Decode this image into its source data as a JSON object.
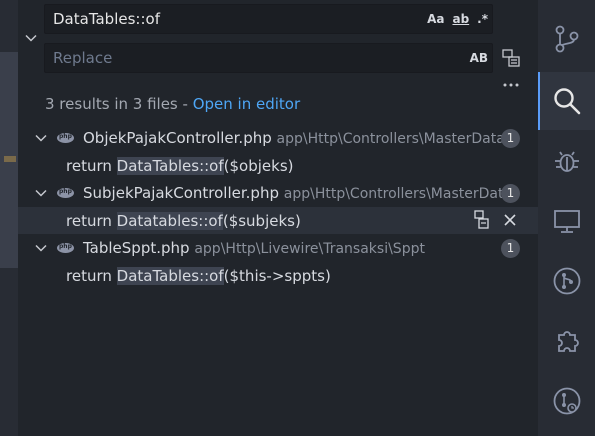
{
  "search": {
    "find_value": "DataTables::of",
    "find_options": {
      "match_case": "Aa",
      "whole_word": "ab",
      "regex": ".*"
    },
    "replace_placeholder": "Replace",
    "replace_option": "AB"
  },
  "summary": {
    "text": "3 results in 3 files - ",
    "link": "Open in editor"
  },
  "results": [
    {
      "file": "ObjekPajakController.php",
      "path": "app\\Http\\Controllers\\MasterData",
      "count": "1",
      "match": {
        "before": "return ",
        "highlight": "DataTables::of",
        "after": "($objeks)"
      }
    },
    {
      "file": "SubjekPajakController.php",
      "path": "app\\Http\\Controllers\\MasterData",
      "count": "1",
      "match": {
        "before": "return ",
        "highlight": "Datatables::of",
        "after": "($subjeks)"
      }
    },
    {
      "file": "TableSppt.php",
      "path": "app\\Http\\Livewire\\Transaksi\\Sppt",
      "count": "1",
      "match": {
        "before": "return ",
        "highlight": "DataTables::of",
        "after": "($this->sppts)"
      }
    }
  ],
  "icons": {
    "activity": [
      "source-control-icon",
      "search-icon",
      "debug-icon",
      "remote-explorer-icon",
      "git-graph-icon",
      "extensions-icon",
      "git-history-icon"
    ],
    "row_actions": [
      "replace-icon",
      "dismiss-icon"
    ]
  },
  "colors": {
    "accent": "#4ea6f5",
    "panel_bg": "#21252b",
    "activity_bg": "#282c34",
    "highlight_bg": "#3e4451"
  }
}
